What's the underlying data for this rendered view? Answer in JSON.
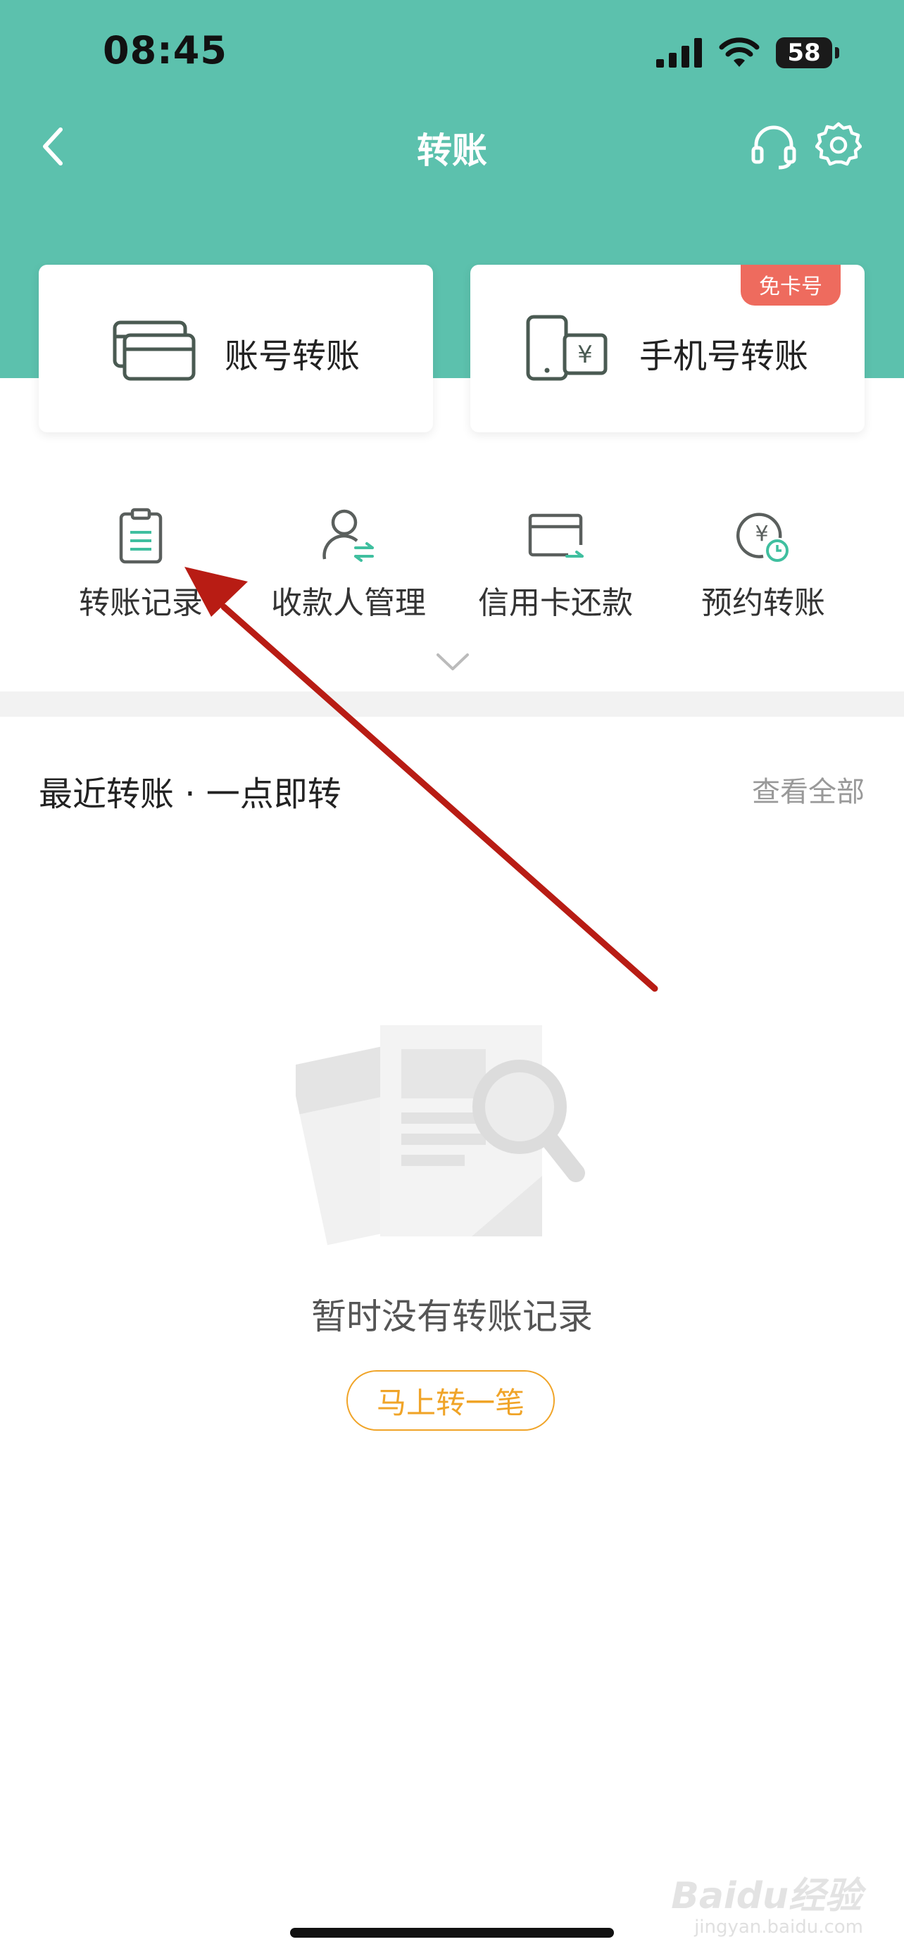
{
  "status_bar": {
    "time": "08:45",
    "battery": "58"
  },
  "nav": {
    "title": "转账",
    "back_icon": "chevron-left-icon",
    "support_icon": "headset-icon",
    "settings_icon": "gear-icon"
  },
  "cards": [
    {
      "label": "账号转账",
      "icon": "bank-card-icon"
    },
    {
      "label": "手机号转账",
      "icon": "phone-yuan-icon",
      "badge": "免卡号"
    }
  ],
  "quick_actions": [
    {
      "label": "转账记录",
      "icon": "clipboard-icon"
    },
    {
      "label": "收款人管理",
      "icon": "payee-icon"
    },
    {
      "label": "信用卡还款",
      "icon": "credit-card-icon"
    },
    {
      "label": "预约转账",
      "icon": "scheduled-yuan-icon"
    }
  ],
  "recent": {
    "title": "最近转账 · 一点即转",
    "view_all": "查看全部"
  },
  "empty_state": {
    "message": "暂时没有转账记录",
    "cta": "马上转一笔"
  },
  "watermark": {
    "brand": "Baidu经验",
    "site": "jingyan.baidu.com"
  },
  "colors": {
    "header": "#5cc1ad",
    "badge": "#ee6b5e",
    "cta": "#f0a428",
    "annotation_arrow": "#b81c14",
    "accent_icon": "#3fbf9f"
  }
}
